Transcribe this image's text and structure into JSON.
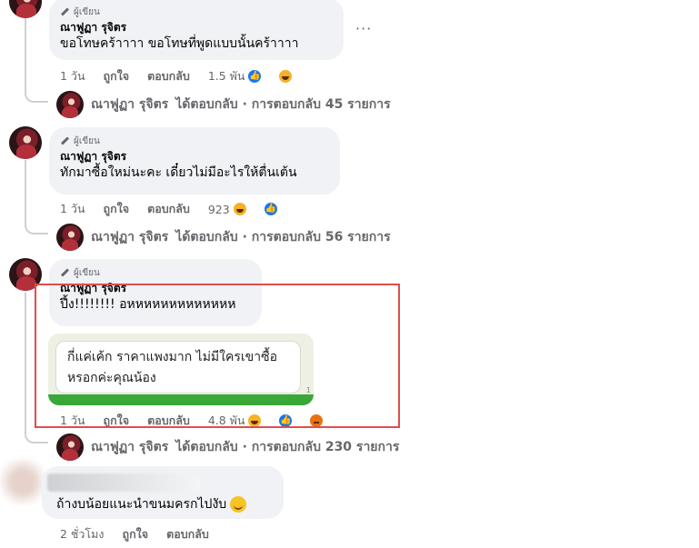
{
  "comments": [
    {
      "author_badge": "ผู้เขียน",
      "author": "ณาฟูฏา รุจิตร",
      "text": "ขอโทษคร้าาาา ขอโทษที่พูดแบบนั้นคร้าาาา",
      "time": "1 วัน",
      "like_label": "ถูกใจ",
      "reply_label": "ตอบกลับ",
      "reaction_count": "1.5 พัน",
      "reactions": [
        "like-icon",
        "haha-icon"
      ],
      "replies_line": {
        "author": "ณาฟูฏา รุจิตร",
        "text": "ได้ตอบกลับ · การตอบกลับ 45 รายการ"
      }
    },
    {
      "author_badge": "ผู้เขียน",
      "author": "ณาฟูฏา รุจิตร",
      "text": "ทักมาซื้อใหม่นะคะ เดี๋ยวไม่มีอะไรให้ตื่นเต้น",
      "time": "1 วัน",
      "like_label": "ถูกใจ",
      "reply_label": "ตอบกลับ",
      "reaction_count": "923",
      "reactions": [
        "haha-icon",
        "like-icon"
      ],
      "replies_line": {
        "author": "ณาฟูฏา รุจิตร",
        "text": "ได้ตอบกลับ · การตอบกลับ 56 รายการ"
      }
    },
    {
      "author_badge": "ผู้เขียน",
      "author": "ณาฟูฏา รุจิตร",
      "text": "ปึ้ง!!!!!!!! อหหหหหหหหหหหหห",
      "attachment_text": "กี่แค่เค้ก ราคาแพงมาก ไม่มีใครเขาซื้อ หรอกค่ะคุณน้อง",
      "attachment_tick": "1",
      "time": "1 วัน",
      "like_label": "ถูกใจ",
      "reply_label": "ตอบกลับ",
      "reaction_count": "4.8 พัน",
      "reactions": [
        "haha-icon",
        "like-icon",
        "angry-icon"
      ],
      "replies_line": {
        "author": "ณาฟูฏา รุจิตร",
        "text": "ได้ตอบกลับ · การตอบกลับ 230 รายการ"
      }
    },
    {
      "text": "ถ้างบน้อยแนะนำขนมครกไปงับ",
      "time": "2 ชั่วโมง",
      "like_label": "ถูกใจ",
      "reply_label": "ตอบกลับ"
    }
  ],
  "more_options": "···",
  "colors": {
    "highlight": "#e24c4b",
    "like": "#1877f2",
    "haha": "#f7b125",
    "angry": "#e9710f"
  }
}
